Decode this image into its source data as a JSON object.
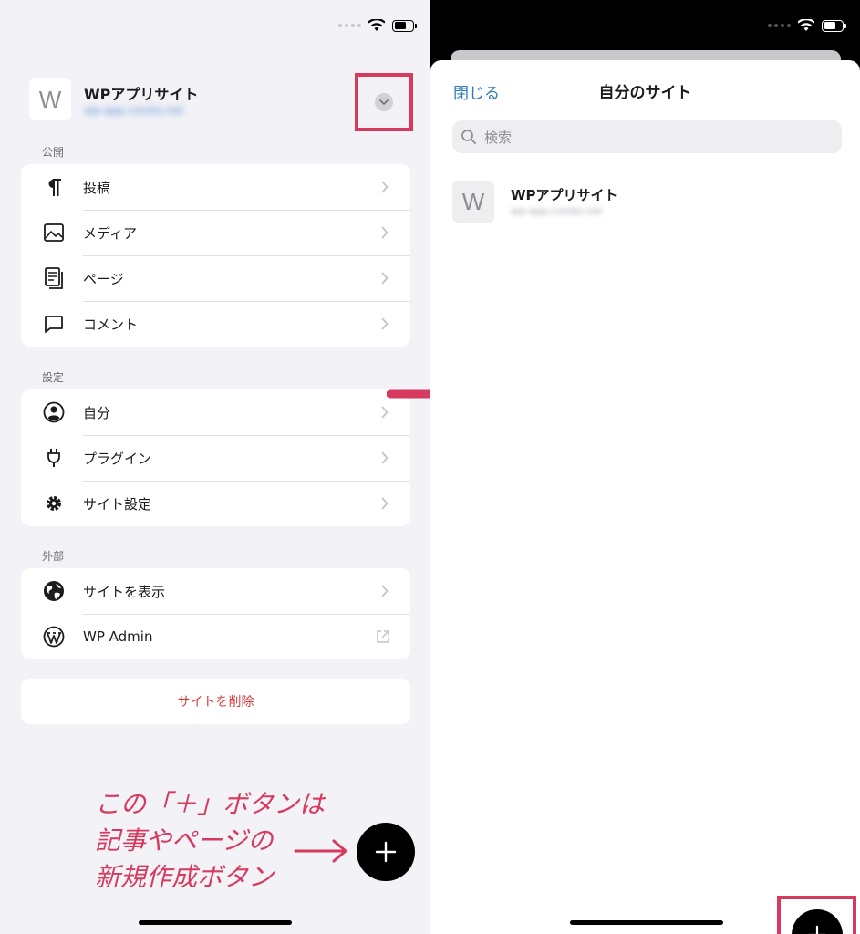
{
  "colors": {
    "accent_annotation": "#d63a5e",
    "link_blue": "#2c7bb6",
    "destructive_red": "#d63a3a",
    "grouped_background": "#f2f2f7"
  },
  "left": {
    "site": {
      "avatar_letter": "W",
      "name": "WPアプリサイト",
      "url": "wp-app.coroto.net"
    },
    "sections": [
      {
        "title": "公開",
        "items": [
          {
            "label": "投稿",
            "icon": "pilcrow-icon"
          },
          {
            "label": "メディア",
            "icon": "image-icon"
          },
          {
            "label": "ページ",
            "icon": "pages-icon"
          },
          {
            "label": "コメント",
            "icon": "comment-icon"
          }
        ]
      },
      {
        "title": "設定",
        "items": [
          {
            "label": "自分",
            "icon": "person-circle-icon"
          },
          {
            "label": "プラグイン",
            "icon": "plug-icon"
          },
          {
            "label": "サイト設定",
            "icon": "gear-icon"
          }
        ]
      },
      {
        "title": "外部",
        "items": [
          {
            "label": "サイトを表示",
            "icon": "globe-icon"
          },
          {
            "label": "WP Admin",
            "icon": "wordpress-icon"
          }
        ]
      }
    ],
    "delete_label": "サイトを削除",
    "annotation_lines": [
      "この「＋」ボタンは",
      "記事やページの",
      "新規作成ボタン"
    ]
  },
  "right": {
    "close_label": "閉じる",
    "title": "自分のサイト",
    "search_placeholder": "検索",
    "site": {
      "avatar_letter": "W",
      "name": "WPアプリサイト",
      "url": "wp-app.coroto.net"
    }
  }
}
